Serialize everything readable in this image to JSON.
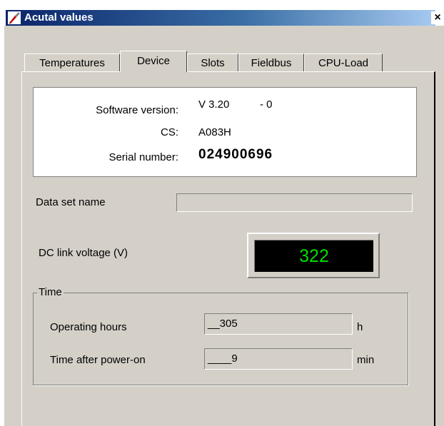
{
  "window": {
    "title": "Acutal values",
    "close_symbol": "×"
  },
  "tabs": [
    {
      "label": "Temperatures",
      "active": false
    },
    {
      "label": "Device",
      "active": true
    },
    {
      "label": "Slots",
      "active": false
    },
    {
      "label": "Fieldbus",
      "active": false
    },
    {
      "label": "CPU-Load",
      "active": false
    }
  ],
  "device_info": {
    "software_version_label": "Software version:",
    "software_version_value": "V 3.20",
    "software_version_suffix": "- 0",
    "cs_label": "CS:",
    "cs_value": "A083H",
    "serial_label": "Serial number:",
    "serial_value": "024900696"
  },
  "data_set": {
    "label": "Data set name",
    "value": ""
  },
  "dc_link": {
    "label": "DC link voltage (V)",
    "value": "322",
    "display_color": "#00e000"
  },
  "time_group": {
    "title": "Time",
    "operating_hours_label": "Operating hours",
    "operating_hours_value": "__305",
    "operating_hours_unit": "h",
    "time_after_power_on_label": "Time after power-on",
    "time_after_power_on_value": "____9",
    "time_after_power_on_unit": "min"
  },
  "icons": {
    "app_icon": "app-icon",
    "close_icon": "close-icon"
  }
}
